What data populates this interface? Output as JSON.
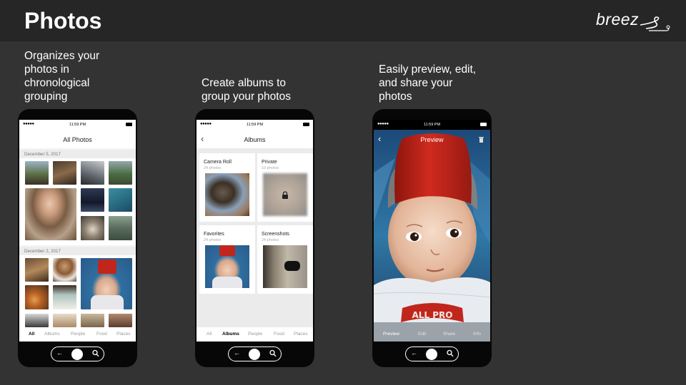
{
  "slide": {
    "title": "Photos",
    "logo_text": "breez",
    "captions": {
      "c1": "Organizes your\nphotos in\nchronological\ngrouping",
      "c2": "Create albums to\ngroup your photos",
      "c3": "Easily preview, edit,\nand share your\nphotos"
    }
  },
  "phone1": {
    "status": {
      "signal": "●●●●●",
      "time": "11:59 PM"
    },
    "title": "All Photos",
    "sections": [
      {
        "date": "December 5, 2017"
      },
      {
        "date": "December 2, 2017"
      }
    ],
    "tabs": [
      "All",
      "Albums",
      "People",
      "Food",
      "Places"
    ],
    "active_tab": "All"
  },
  "phone2": {
    "status": {
      "signal": "●●●●●",
      "time": "11:59 PM"
    },
    "back": "‹",
    "title": "Albums",
    "albums": [
      {
        "name": "Camera Roll",
        "count": "24 photos"
      },
      {
        "name": "Private",
        "count": "10 photos",
        "locked": true
      },
      {
        "name": "Favorites",
        "count": "24 photos"
      },
      {
        "name": "Screenshots",
        "count": "24 photos"
      }
    ],
    "tabs": [
      "All",
      "Albums",
      "People",
      "Food",
      "Places"
    ],
    "active_tab": "Albums"
  },
  "phone3": {
    "status": {
      "signal": "●●●●●",
      "time": "11:59 PM"
    },
    "back": "‹",
    "title": "Preview",
    "bib_text": "ALL PRO",
    "tabs": [
      "Preview",
      "Edit",
      "Share",
      "Info"
    ],
    "active_tab": "Preview"
  },
  "homebar": {
    "back_arrow": "←"
  },
  "colors": {
    "background": "#333333",
    "header_bar": "#262626",
    "phone_body": "#070707",
    "fez_red": "#c1261c"
  }
}
